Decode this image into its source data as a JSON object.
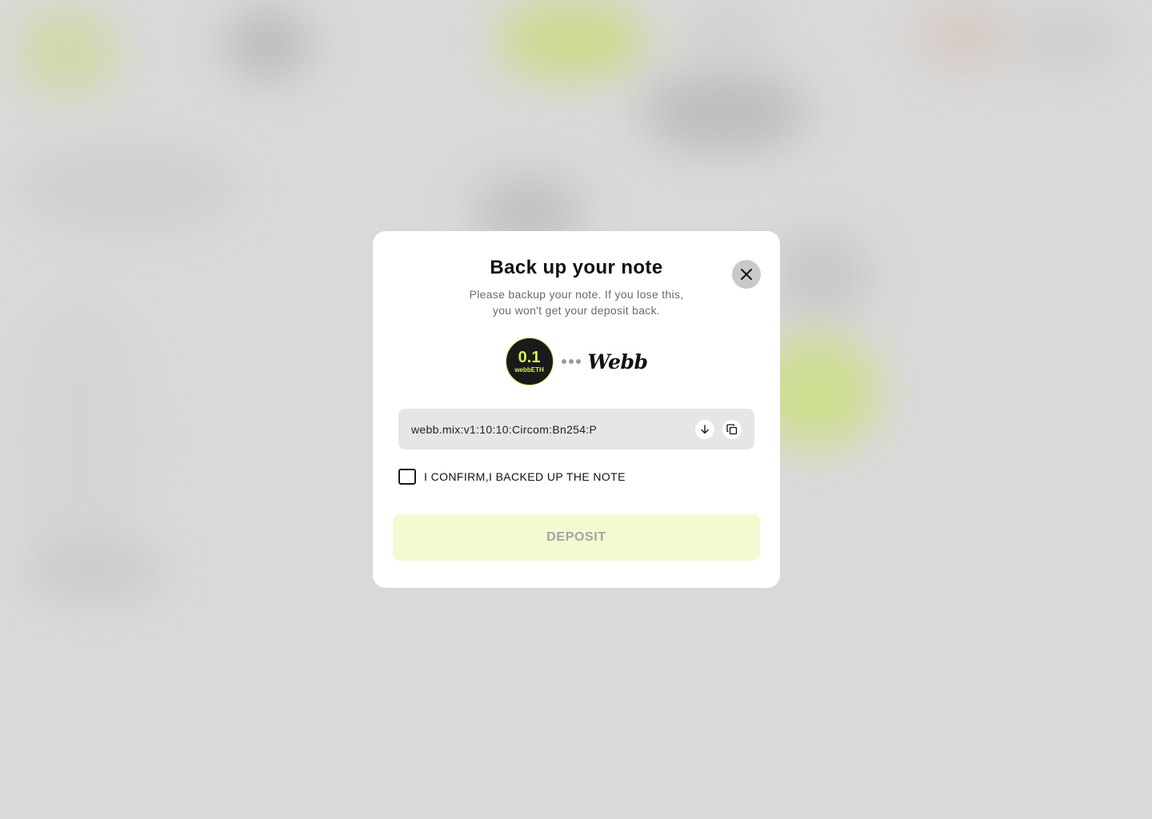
{
  "modal": {
    "title": "Back up your note",
    "subtitle_line1": "Please backup your note. If you lose this,",
    "subtitle_line2": "you won't get your deposit back.",
    "close_icon": "close-icon"
  },
  "token": {
    "amount": "0.1",
    "symbol": "webbETH",
    "brand": "Webb",
    "accent_color": "#d6f24d"
  },
  "note": {
    "value": "webb.mix:v1:10:10:Circom:Bn254:P",
    "download_icon": "download-icon",
    "copy_icon": "copy-icon"
  },
  "confirm": {
    "label": "I CONFIRM,I BACKED UP THE NOTE",
    "checked": false
  },
  "deposit": {
    "label": "DEPOSIT",
    "enabled": false
  },
  "colors": {
    "overlay": "#d9d9d9",
    "modal_background": "#ffffff",
    "button_disabled_background": "#f3fad0",
    "button_disabled_text": "#a3a3a3"
  }
}
